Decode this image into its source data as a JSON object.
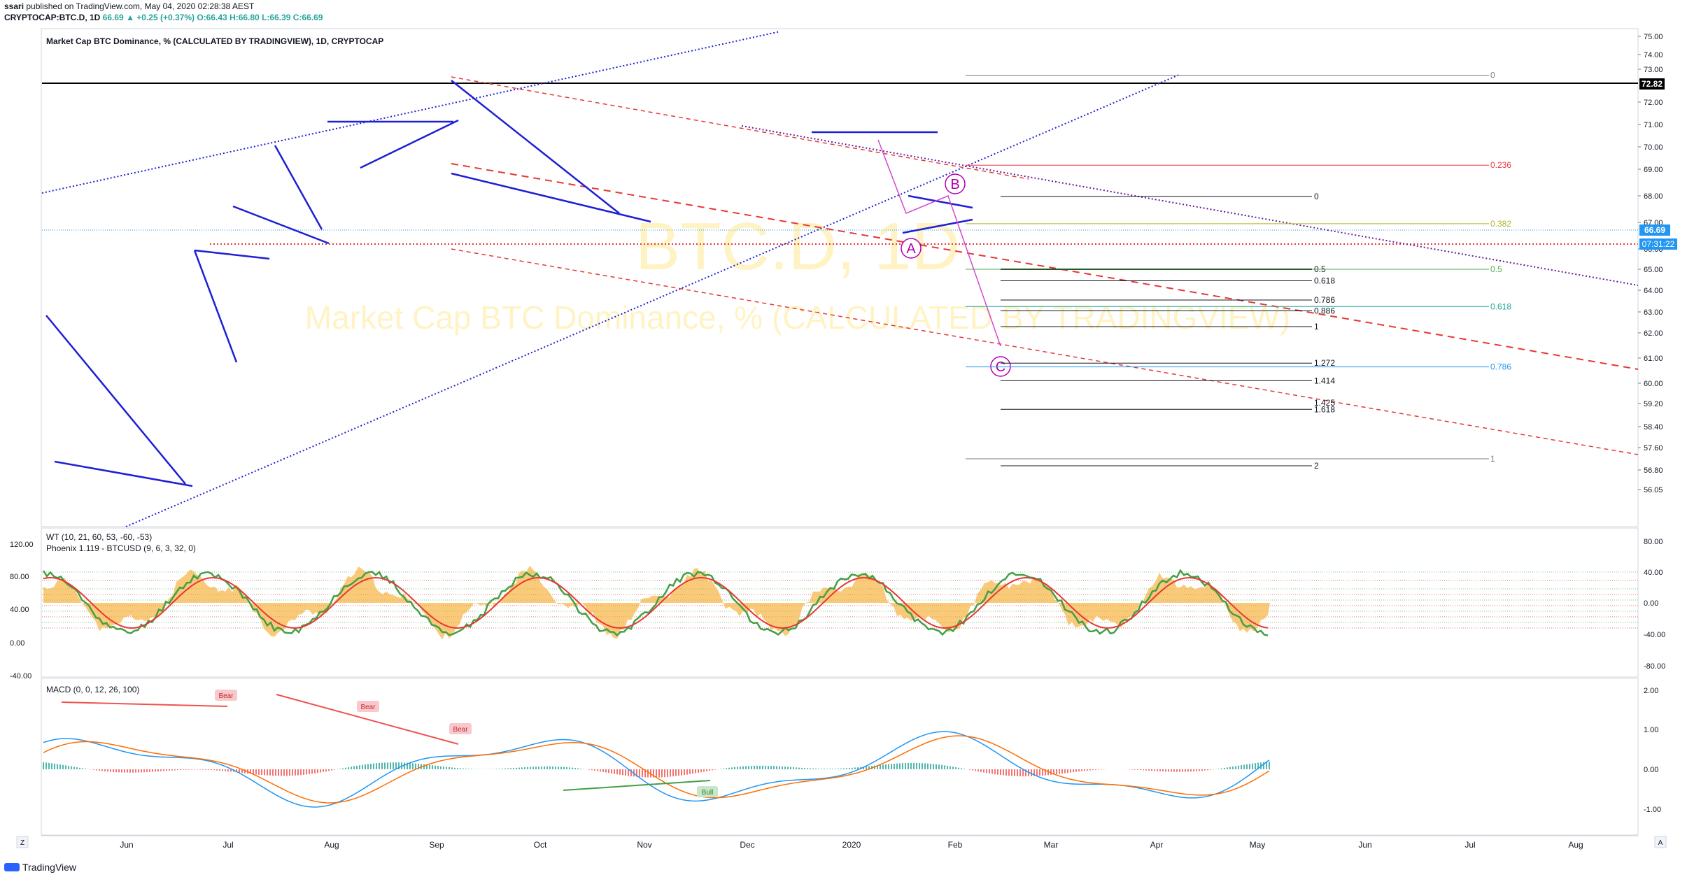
{
  "header": {
    "author": "ssari",
    "published_line": "published on TradingView.com, May 04, 2020 02:28:38 AEST",
    "symbol": "CRYPTOCAP:BTC.D, 1D",
    "last": "66.69",
    "change": "▲ +0.25 (+0.37%)",
    "ohlc": "O:66.43 H:66.80 L:66.39 C:66.69"
  },
  "main_pane": {
    "title": "Market Cap BTC Dominance, % (CALCULATED BY TRADINGVIEW), 1D, CRYPTOCAP",
    "watermark_big": "BTC.D, 1D",
    "watermark_small": "Market Cap BTC Dominance, % (CALCULATED BY TRADINGVIEW)",
    "y_ticks": [
      "75.00",
      "74.00",
      "73.00",
      "72.00",
      "71.00",
      "70.00",
      "69.00",
      "68.00",
      "67.00",
      "66.00",
      "65.00",
      "64.00",
      "63.00",
      "62.00",
      "61.00",
      "60.00",
      "59.20",
      "58.40",
      "57.60",
      "56.80",
      "56.05"
    ],
    "last_price_label": "66.69",
    "countdown_label": "07:31:22",
    "level_label": "72.82",
    "wave_labels": [
      "A",
      "B",
      "C"
    ]
  },
  "fib_left": {
    "levels": [
      {
        "label": "0",
        "value": 67.98
      },
      {
        "label": "0.5",
        "value": 65.0
      },
      {
        "label": "0.618",
        "value": 64.45
      },
      {
        "label": "0.786",
        "value": 63.55
      },
      {
        "label": "0.886",
        "value": 63.05
      },
      {
        "label": "1",
        "value": 62.3
      },
      {
        "label": "1.272",
        "value": 60.8
      },
      {
        "label": "1.414",
        "value": 60.1
      },
      {
        "label": "1.618",
        "value": 59.0
      },
      {
        "label": "2",
        "value": 56.95
      }
    ],
    "overlap_label": "1.425",
    "colors": {
      "default": "#131722",
      "0.5": "#000000"
    }
  },
  "fib_right": {
    "levels": [
      {
        "label": "0",
        "value": 72.82,
        "color": "#787b86"
      },
      {
        "label": "0.236",
        "value": 69.18,
        "color": "#f23645"
      },
      {
        "label": "0.382",
        "value": 66.95,
        "color": "#b2b52a"
      },
      {
        "label": "0.5",
        "value": 65.0,
        "color": "#4caf50"
      },
      {
        "label": "0.618",
        "value": 63.25,
        "color": "#26a69a"
      },
      {
        "label": "0.786",
        "value": 60.65,
        "color": "#2196f3"
      },
      {
        "label": "1",
        "value": 57.2,
        "color": "#787b86"
      }
    ]
  },
  "wt_pane": {
    "title": "WT (10, 21, 60, 53, -60, -53)",
    "subtitle": "Phoenix 1.119 - BTCUSD (9, 6, 3, 32, 0)",
    "left_ticks": [
      "120.00",
      "80.00",
      "40.00",
      "0.00",
      "-40.00"
    ],
    "right_ticks": [
      "80.00",
      "40.00",
      "0.00",
      "-40.00",
      "-80.00"
    ]
  },
  "macd_pane": {
    "title": "MACD (0, 0, 12, 26, 100)",
    "right_ticks": [
      "2.00",
      "1.00",
      "0.00",
      "-1.00"
    ],
    "divergence_labels": [
      "Bear",
      "Bear",
      "Bear",
      "Bull"
    ]
  },
  "time_axis": {
    "labels": [
      "Jun",
      "Jul",
      "Aug",
      "Sep",
      "Oct",
      "Nov",
      "Dec",
      "2020",
      "Feb",
      "Mar",
      "Apr",
      "May",
      "Jun",
      "Jul",
      "Aug"
    ],
    "left_button": "Z",
    "right_button": "A"
  },
  "footer": {
    "logo_text": "TradingView"
  },
  "colors": {
    "up": "#26a69a",
    "down": "#ef5350",
    "trend_blue": "#1f1fd6",
    "channel_red": "#e53935",
    "watermark": "#fff3c4",
    "wt_fill": "#f7a623",
    "wt_green": "#43a047",
    "wt_red": "#e53935",
    "macd_blue": "#2196f3",
    "macd_orange": "#ff6d00",
    "magenta": "#b000b0"
  },
  "chart_data": {
    "type": "candlestick",
    "title": "Market Cap BTC Dominance, % (CALCULATED BY TRADINGVIEW), 1D, CRYPTOCAP",
    "ylim": [
      55.8,
      75.4
    ],
    "x": [
      "Jun",
      "Jul",
      "Aug",
      "Sep",
      "Oct",
      "Nov",
      "Dec",
      "2020",
      "Feb",
      "Mar",
      "Apr",
      "May"
    ],
    "approx_close_path": [
      {
        "x": "May 15",
        "y": 62.0
      },
      {
        "x": "May 20",
        "y": 63.1
      },
      {
        "x": "May 25",
        "y": 60.3
      },
      {
        "x": "Jun 1",
        "y": 60.6
      },
      {
        "x": "Jun 10",
        "y": 59.8
      },
      {
        "x": "Jun 20",
        "y": 58.8
      },
      {
        "x": "Jun 26",
        "y": 62.4
      },
      {
        "x": "Jul 1",
        "y": 63.2
      },
      {
        "x": "Jul 5",
        "y": 65.7
      },
      {
        "x": "Jul 10",
        "y": 68.2
      },
      {
        "x": "Jul 14",
        "y": 69.5
      },
      {
        "x": "Jul 20",
        "y": 68.6
      },
      {
        "x": "Jul 28",
        "y": 67.2
      },
      {
        "x": "Aug 5",
        "y": 70.0
      },
      {
        "x": "Aug 10",
        "y": 71.3
      },
      {
        "x": "Aug 20",
        "y": 71.0
      },
      {
        "x": "Aug 31",
        "y": 71.6
      },
      {
        "x": "Sep 6",
        "y": 72.7
      },
      {
        "x": "Sep 12",
        "y": 71.6
      },
      {
        "x": "Sep 20",
        "y": 69.3
      },
      {
        "x": "Oct 1",
        "y": 68.8
      },
      {
        "x": "Oct 10",
        "y": 68.2
      },
      {
        "x": "Oct 20",
        "y": 68.0
      },
      {
        "x": "Oct 25",
        "y": 69.8
      },
      {
        "x": "Nov 5",
        "y": 68.5
      },
      {
        "x": "Nov 15",
        "y": 67.7
      },
      {
        "x": "Nov 30",
        "y": 68.4
      },
      {
        "x": "Dec 10",
        "y": 68.8
      },
      {
        "x": "Dec 20",
        "y": 70.3
      },
      {
        "x": "Jan 1",
        "y": 70.3
      },
      {
        "x": "Jan 10",
        "y": 69.5
      },
      {
        "x": "Jan 15",
        "y": 67.0
      },
      {
        "x": "Jan 25",
        "y": 67.2
      },
      {
        "x": "Feb 1",
        "y": 66.6
      },
      {
        "x": "Feb 8",
        "y": 64.3
      },
      {
        "x": "Feb 14",
        "y": 62.3
      },
      {
        "x": "Feb 20",
        "y": 63.6
      },
      {
        "x": "Mar 1",
        "y": 65.3
      },
      {
        "x": "Mar 10",
        "y": 64.9
      },
      {
        "x": "Mar 20",
        "y": 66.3
      },
      {
        "x": "Mar 25",
        "y": 67.9
      },
      {
        "x": "Apr 1",
        "y": 66.3
      },
      {
        "x": "Apr 10",
        "y": 65.0
      },
      {
        "x": "Apr 18",
        "y": 64.3
      },
      {
        "x": "Apr 25",
        "y": 64.7
      },
      {
        "x": "May 3",
        "y": 66.69
      }
    ]
  }
}
